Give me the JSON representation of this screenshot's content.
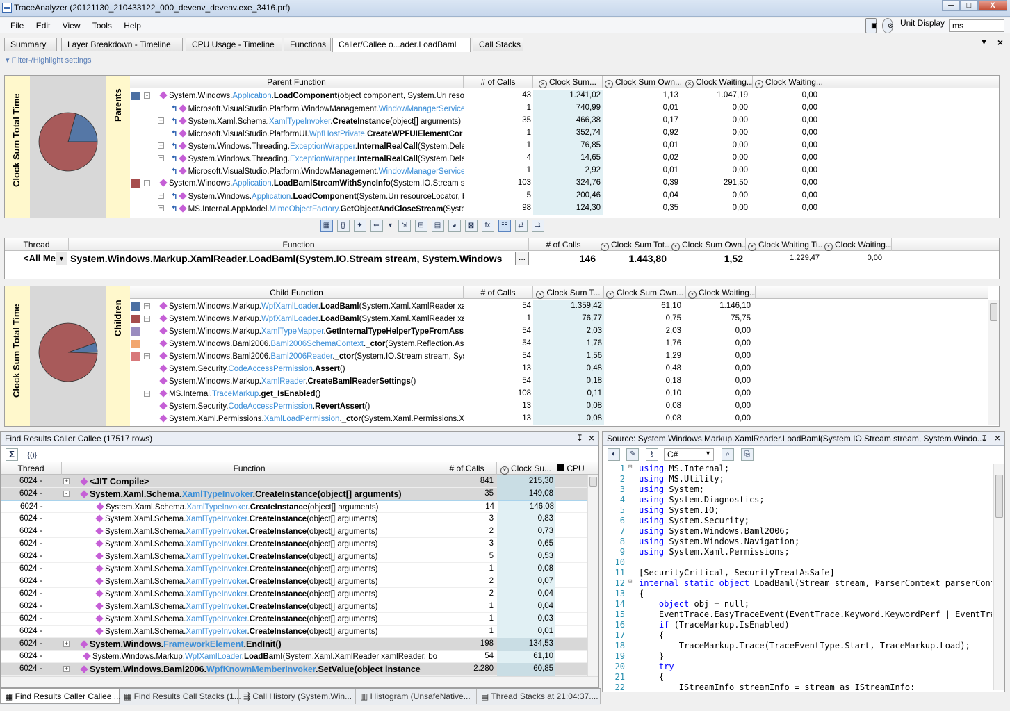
{
  "window": {
    "title": "TraceAnalyzer (20121130_210433122_000_devenv_devenv.exe_3416.prf)",
    "min": "─",
    "max": "□",
    "close": "X"
  },
  "menu": {
    "items": [
      "File",
      "Edit",
      "View",
      "Tools",
      "Help"
    ],
    "unit_label": "Unit Display",
    "unit_value": "ms"
  },
  "tabs": [
    "Summary",
    "Layer Breakdown - Timeline",
    "CPU Usage - Timeline",
    "Functions",
    "Caller/Callee   o...ader.LoadBaml",
    "Call Stacks"
  ],
  "filter": "Filter-/Highlight settings",
  "parents": {
    "side_label": "Clock Sum Total Time",
    "section_label": "Parents",
    "headers": [
      "Parent Function",
      "# of Calls",
      "Clock Sum...",
      "Clock Sum Own...",
      "Clock Waiting...",
      "Clock Waiting..."
    ],
    "rows": [
      {
        "color": "#4b6fa3",
        "expand": "-",
        "indent": 0,
        "pre": "System.Windows.",
        "blue": "Application",
        "dot": ".",
        "bold": "LoadComponent",
        "post": "(object component, System.Uri resource",
        "calls": "43",
        "sum": "1.241,02",
        "own": "1,13",
        "wait": "1.047,19",
        "wait2": "0,00"
      },
      {
        "color": "",
        "expand": "",
        "indent": 1,
        "pre": "Microsoft.VisualStudio.Platform.WindowManagement.",
        "blue": "WindowManagerService",
        "dot": ".",
        "bold": "L",
        "post": "",
        "calls": "1",
        "sum": "740,99",
        "own": "0,01",
        "wait": "0,00",
        "wait2": "0,00"
      },
      {
        "color": "",
        "expand": "+",
        "indent": 1,
        "pre": "System.Xaml.Schema.",
        "blue": "XamlTypeInvoker",
        "dot": ".",
        "bold": "CreateInstance",
        "post": "(object[] arguments)",
        "calls": "35",
        "sum": "466,38",
        "own": "0,17",
        "wait": "0,00",
        "wait2": "0,00"
      },
      {
        "color": "",
        "expand": "",
        "indent": 1,
        "pre": "Microsoft.VisualStudio.PlatformUI.",
        "blue": "WpfHostPrivate",
        "dot": ".",
        "bold": "CreateWPFUIElementCor",
        "post": "",
        "calls": "1",
        "sum": "352,74",
        "own": "0,92",
        "wait": "0,00",
        "wait2": "0,00"
      },
      {
        "color": "",
        "expand": "+",
        "indent": 1,
        "pre": "System.Windows.Threading.",
        "blue": "ExceptionWrapper",
        "dot": ".",
        "bold": "InternalRealCall",
        "post": "(System.Dele",
        "calls": "1",
        "sum": "76,85",
        "own": "0,01",
        "wait": "0,00",
        "wait2": "0,00"
      },
      {
        "color": "",
        "expand": "+",
        "indent": 1,
        "pre": "System.Windows.Threading.",
        "blue": "ExceptionWrapper",
        "dot": ".",
        "bold": "InternalRealCall",
        "post": "(System.Dele",
        "calls": "4",
        "sum": "14,65",
        "own": "0,02",
        "wait": "0,00",
        "wait2": "0,00"
      },
      {
        "color": "",
        "expand": "",
        "indent": 1,
        "pre": "Microsoft.VisualStudio.Platform.WindowManagement.",
        "blue": "WindowManagerService",
        "dot": ".",
        "bold": "C",
        "post": "",
        "calls": "1",
        "sum": "2,92",
        "own": "0,01",
        "wait": "0,00",
        "wait2": "0,00"
      },
      {
        "color": "#a64d4d",
        "expand": "-",
        "indent": 0,
        "pre": "System.Windows.",
        "blue": "Application",
        "dot": ".",
        "bold": "LoadBamlStreamWithSyncInfo",
        "post": "(System.IO.Stream strea",
        "calls": "103",
        "sum": "324,76",
        "own": "0,39",
        "wait": "291,50",
        "wait2": "0,00"
      },
      {
        "color": "",
        "expand": "+",
        "indent": 1,
        "pre": "System.Windows.",
        "blue": "Application",
        "dot": ".",
        "bold": "LoadComponent",
        "post": "(System.Uri resourceLocator, bc",
        "calls": "5",
        "sum": "200,46",
        "own": "0,04",
        "wait": "0,00",
        "wait2": "0,00"
      },
      {
        "color": "",
        "expand": "+",
        "indent": 1,
        "pre": "MS.Internal.AppModel.",
        "blue": "MimeObjectFactory",
        "dot": ".",
        "bold": "GetObjectAndCloseStream",
        "post": "(Syste",
        "calls": "98",
        "sum": "124,30",
        "own": "0,35",
        "wait": "0,00",
        "wait2": "0,00"
      }
    ]
  },
  "toolbar_icons": [
    "grid-icon",
    "braces-icon",
    "highlight-icon",
    "navigate-icon",
    "dropdown-icon",
    "export-icon",
    "tree-icon",
    "table-icon",
    "pie-icon",
    "color-icon",
    "fx-icon",
    "calltree-icon",
    "swap-icon",
    "arrows-icon"
  ],
  "current": {
    "headers": [
      "Thread",
      "Function",
      "# of Calls",
      "Clock Sum Tot...",
      "Clock Sum Own...",
      "Clock Waiting Ti...",
      "Clock Waiting..."
    ],
    "thread": "<All Me",
    "function": "System.Windows.Markup.XamlReader.LoadBaml(System.IO.Stream stream, System.Windows",
    "calls": "146",
    "sum": "1.443,80",
    "own": "1,52",
    "wait": "1.229,47",
    "wait2": "0,00",
    "ellipsis": "..."
  },
  "children": {
    "side_label": "Clock Sum Total Time",
    "section_label": "Children",
    "headers": [
      "Child Function",
      "# of Calls",
      "Clock Sum T...",
      "Clock Sum Own...",
      "Clock Waiting..."
    ],
    "rows": [
      {
        "color": "#4b6fa3",
        "expand": "+",
        "pre": "System.Windows.Markup.",
        "blue": "WpfXamlLoader",
        "dot": ".",
        "bold": "LoadBaml",
        "post": "(System.Xaml.XamlReader xamlRe",
        "calls": "54",
        "sum": "1.359,42",
        "own": "61,10",
        "wait": "1.146,10"
      },
      {
        "color": "#a64d4d",
        "expand": "+",
        "pre": "System.Windows.Markup.",
        "blue": "WpfXamlLoader",
        "dot": ".",
        "bold": "LoadBaml",
        "post": "(System.Xaml.XamlReader xamlRe",
        "calls": "1",
        "sum": "76,77",
        "own": "0,75",
        "wait": "75,75"
      },
      {
        "color": "#9a8cc0",
        "expand": "",
        "pre": "System.Windows.Markup.",
        "blue": "XamlTypeMapper",
        "dot": ".",
        "bold": "GetInternalTypeHelperTypeFromAsse",
        "post": "",
        "calls": "54",
        "sum": "2,03",
        "own": "2,03",
        "wait": "0,00"
      },
      {
        "color": "#f2a66f",
        "expand": "",
        "pre": "System.Windows.Baml2006.",
        "blue": "Baml2006SchemaContext",
        "dot": ".",
        "bold": "_ctor",
        "post": "(System.Reflection.Assemb",
        "calls": "54",
        "sum": "1,76",
        "own": "1,76",
        "wait": "0,00"
      },
      {
        "color": "#d8787a",
        "expand": "+",
        "pre": "System.Windows.Baml2006.",
        "blue": "Baml2006Reader",
        "dot": ".",
        "bold": "_ctor",
        "post": "(System.IO.Stream stream, System.\\",
        "calls": "54",
        "sum": "1,56",
        "own": "1,29",
        "wait": "0,00"
      },
      {
        "color": "",
        "expand": "",
        "pre": "System.Security.",
        "blue": "CodeAccessPermission",
        "dot": ".",
        "bold": "Assert",
        "post": "()",
        "calls": "13",
        "sum": "0,48",
        "own": "0,48",
        "wait": "0,00"
      },
      {
        "color": "",
        "expand": "",
        "pre": "System.Windows.Markup.",
        "blue": "XamlReader",
        "dot": ".",
        "bold": "CreateBamlReaderSettings",
        "post": "()",
        "calls": "54",
        "sum": "0,18",
        "own": "0,18",
        "wait": "0,00"
      },
      {
        "color": "",
        "expand": "+",
        "pre": "MS.Internal.",
        "blue": "TraceMarkup",
        "dot": ".",
        "bold": "get_IsEnabled",
        "post": "()",
        "calls": "108",
        "sum": "0,11",
        "own": "0,10",
        "wait": "0,00"
      },
      {
        "color": "",
        "expand": "",
        "pre": "System.Security.",
        "blue": "CodeAccessPermission",
        "dot": ".",
        "bold": "RevertAssert",
        "post": "()",
        "calls": "13",
        "sum": "0,08",
        "own": "0,08",
        "wait": "0,00"
      },
      {
        "color": "",
        "expand": "",
        "pre": "System.Xaml.Permissions.",
        "blue": "XamlLoadPermission",
        "dot": ".",
        "bold": "_ctor",
        "post": "(System.Xaml.Permissions.XamlAcc",
        "calls": "13",
        "sum": "0,08",
        "own": "0,08",
        "wait": "0,00"
      }
    ]
  },
  "find": {
    "title": "Find Results Caller Callee (17517 rows)",
    "pin": "↧",
    "close": "×",
    "sigma": "Σ",
    "braces": "{()}",
    "headers": [
      "Thread",
      "Function",
      "# of Calls",
      "Clock Su...",
      "CPU"
    ],
    "rows": [
      {
        "thread": "6024 -",
        "expand": "+",
        "group": true,
        "pre": "<JIT Compile>",
        "blue": "",
        "dot": "",
        "bold": "",
        "post": "",
        "calls": "841",
        "sum": "215,30"
      },
      {
        "thread": "6024 -",
        "expand": "-",
        "group": true,
        "pre": "System.Xaml.Schema.",
        "blue": "XamlTypeInvoker",
        "dot": ".",
        "bold": "CreateInstance",
        "post": "(object[] arguments)",
        "calls": "35",
        "sum": "149,08"
      },
      {
        "thread": "6024 -",
        "expand": "",
        "group": false,
        "pre": "System.Xaml.Schema.",
        "blue": "XamlTypeInvoker",
        "dot": ".",
        "bold": "CreateInstance",
        "post": "(object[] arguments)",
        "calls": "14",
        "sum": "146,08"
      },
      {
        "thread": "6024 -",
        "expand": "",
        "group": false,
        "pre": "System.Xaml.Schema.",
        "blue": "XamlTypeInvoker",
        "dot": ".",
        "bold": "CreateInstance",
        "post": "(object[] arguments)",
        "calls": "3",
        "sum": "0,83"
      },
      {
        "thread": "6024 -",
        "expand": "",
        "group": false,
        "pre": "System.Xaml.Schema.",
        "blue": "XamlTypeInvoker",
        "dot": ".",
        "bold": "CreateInstance",
        "post": "(object[] arguments)",
        "calls": "2",
        "sum": "0,73"
      },
      {
        "thread": "6024 -",
        "expand": "",
        "group": false,
        "pre": "System.Xaml.Schema.",
        "blue": "XamlTypeInvoker",
        "dot": ".",
        "bold": "CreateInstance",
        "post": "(object[] arguments)",
        "calls": "3",
        "sum": "0,65"
      },
      {
        "thread": "6024 -",
        "expand": "",
        "group": false,
        "pre": "System.Xaml.Schema.",
        "blue": "XamlTypeInvoker",
        "dot": ".",
        "bold": "CreateInstance",
        "post": "(object[] arguments)",
        "calls": "5",
        "sum": "0,53"
      },
      {
        "thread": "6024 -",
        "expand": "",
        "group": false,
        "pre": "System.Xaml.Schema.",
        "blue": "XamlTypeInvoker",
        "dot": ".",
        "bold": "CreateInstance",
        "post": "(object[] arguments)",
        "calls": "1",
        "sum": "0,08"
      },
      {
        "thread": "6024 -",
        "expand": "",
        "group": false,
        "pre": "System.Xaml.Schema.",
        "blue": "XamlTypeInvoker",
        "dot": ".",
        "bold": "CreateInstance",
        "post": "(object[] arguments)",
        "calls": "2",
        "sum": "0,07"
      },
      {
        "thread": "6024 -",
        "expand": "",
        "group": false,
        "pre": "System.Xaml.Schema.",
        "blue": "XamlTypeInvoker",
        "dot": ".",
        "bold": "CreateInstance",
        "post": "(object[] arguments)",
        "calls": "2",
        "sum": "0,04"
      },
      {
        "thread": "6024 -",
        "expand": "",
        "group": false,
        "pre": "System.Xaml.Schema.",
        "blue": "XamlTypeInvoker",
        "dot": ".",
        "bold": "CreateInstance",
        "post": "(object[] arguments)",
        "calls": "1",
        "sum": "0,04"
      },
      {
        "thread": "6024 -",
        "expand": "",
        "group": false,
        "pre": "System.Xaml.Schema.",
        "blue": "XamlTypeInvoker",
        "dot": ".",
        "bold": "CreateInstance",
        "post": "(object[] arguments)",
        "calls": "1",
        "sum": "0,03"
      },
      {
        "thread": "6024 -",
        "expand": "",
        "group": false,
        "pre": "System.Xaml.Schema.",
        "blue": "XamlTypeInvoker",
        "dot": ".",
        "bold": "CreateInstance",
        "post": "(object[] arguments)",
        "calls": "1",
        "sum": "0,01"
      },
      {
        "thread": "6024 -",
        "expand": "+",
        "group": true,
        "pre": "System.Windows.",
        "blue": "FrameworkElement",
        "dot": ".",
        "bold": "EndInit",
        "post": "()",
        "calls": "198",
        "sum": "134,53"
      },
      {
        "thread": "6024 -",
        "expand": "",
        "group": false,
        "pre": "System.Windows.Markup.",
        "blue": "WpfXamlLoader",
        "dot": ".",
        "bold": "LoadBaml",
        "post": "(System.Xaml.XamlReader xamlReader, bool skipJ",
        "calls": "54",
        "sum": "61,10"
      },
      {
        "thread": "6024 -",
        "expand": "+",
        "group": true,
        "pre": "System.Windows.Baml2006.",
        "blue": "WpfKnownMemberInvoker",
        "dot": ".",
        "bold": "SetValue",
        "post": "(object instance",
        "calls": "2.280",
        "sum": "60,85"
      }
    ]
  },
  "source": {
    "title": "Source: System.Windows.Markup.XamlReader.LoadBaml(System.IO.Stream stream, System.Windo...",
    "pin": "↧",
    "close": "×",
    "language": "C#",
    "lines": [
      {
        "n": "1",
        "kw": "using",
        "rest": " MS.Internal;"
      },
      {
        "n": "2",
        "kw": "using",
        "rest": " MS.Utility;"
      },
      {
        "n": "3",
        "kw": "using",
        "rest": " System;"
      },
      {
        "n": "4",
        "kw": "using",
        "rest": " System.Diagnostics;"
      },
      {
        "n": "5",
        "kw": "using",
        "rest": " System.IO;"
      },
      {
        "n": "6",
        "kw": "using",
        "rest": " System.Security;"
      },
      {
        "n": "7",
        "kw": "using",
        "rest": " System.Windows.Baml2006;"
      },
      {
        "n": "8",
        "kw": "using",
        "rest": " System.Windows.Navigation;"
      },
      {
        "n": "9",
        "kw": "using",
        "rest": " System.Xaml.Permissions;"
      },
      {
        "n": "10",
        "kw": "",
        "rest": ""
      },
      {
        "n": "11",
        "kw": "",
        "rest": "[SecurityCritical, SecurityTreatAsSafe]"
      },
      {
        "n": "12",
        "kw": "internal static object",
        "rest": " LoadBaml(Stream stream, ParserContext parserConte"
      },
      {
        "n": "13",
        "kw": "",
        "rest": "{"
      },
      {
        "n": "14",
        "kw": "    object",
        "rest": " obj = null;",
        "kw2": "null"
      },
      {
        "n": "15",
        "kw": "",
        "rest": "    EventTrace.EasyTraceEvent(EventTrace.Keyword.KeywordPerf | EventTrac"
      },
      {
        "n": "16",
        "kw": "    if",
        "rest": " (TraceMarkup.IsEnabled)"
      },
      {
        "n": "17",
        "kw": "",
        "rest": "    {"
      },
      {
        "n": "18",
        "kw": "",
        "rest": "        TraceMarkup.Trace(TraceEventType.Start, TraceMarkup.Load);"
      },
      {
        "n": "19",
        "kw": "",
        "rest": "    }"
      },
      {
        "n": "20",
        "kw": "    try",
        "rest": ""
      },
      {
        "n": "21",
        "kw": "",
        "rest": "    {"
      },
      {
        "n": "22",
        "kw": "",
        "rest": "        IStreamInfo streamInfo = stream as IStreamInfo;"
      }
    ]
  },
  "bottom_tabs": [
    "Find Results Caller Callee ...",
    "Find Results Call Stacks (1...",
    "Call History (System.Win...",
    "Histogram (UnsafeNative...",
    "Thread Stacks at 21:04:37...."
  ],
  "colors": {
    "pie_blue": "#5577a6",
    "pie_red": "#a85a5a",
    "number_shade": "#e1f0f4",
    "link_blue": "#3a8ed8",
    "sidebar_yellow": "#fff8cc"
  },
  "pies": {
    "parents": {
      "segments": [
        0.7931,
        0.2069
      ]
    },
    "children": {
      "segments": [
        0.9415,
        0.0532
      ]
    }
  }
}
